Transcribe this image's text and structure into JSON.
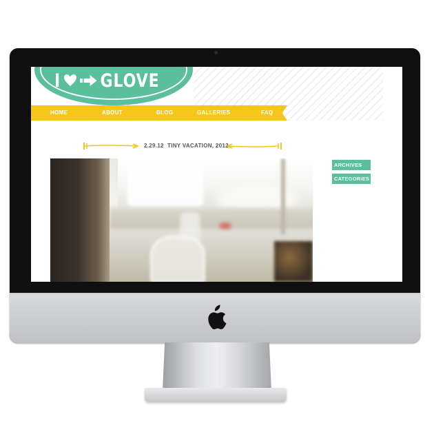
{
  "device": {
    "type": "iMac",
    "logo": "apple-logo-icon"
  },
  "site": {
    "logo": {
      "prefix": "I",
      "heart_icon": "heart-icon",
      "arrow_icon": "arrow-right-icon",
      "word": "GLOVE"
    },
    "nav": {
      "items": [
        "HOME",
        "ABOUT",
        "BLOG",
        "GALLERIES",
        "FAQ"
      ]
    },
    "post": {
      "date": "2.29.12",
      "title": "TINY VACATION, 2012."
    },
    "sidebar": {
      "buttons": [
        "ARCHIVES",
        "CATEGORIES"
      ]
    },
    "colors": {
      "accent_green": "#5abf9a",
      "accent_yellow": "#f6c61a",
      "text_gray": "#555555"
    }
  }
}
